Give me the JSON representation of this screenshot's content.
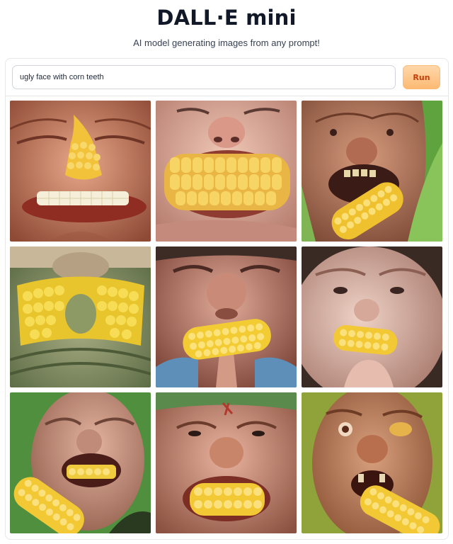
{
  "app": {
    "title": "DALL·E mini",
    "subtitle": "AI model generating images from any prompt!"
  },
  "prompt": {
    "value": "ugly face with corn teeth"
  },
  "run_button": {
    "label": "Run"
  },
  "colors": {
    "run_accent": "#c2410c",
    "run_background": "#fed7aa",
    "corn": "#f5c542"
  },
  "gallery": {
    "images": [
      {
        "depicts": "generated-image-1"
      },
      {
        "depicts": "generated-image-2"
      },
      {
        "depicts": "generated-image-3"
      },
      {
        "depicts": "generated-image-4"
      },
      {
        "depicts": "generated-image-5"
      },
      {
        "depicts": "generated-image-6"
      },
      {
        "depicts": "generated-image-7"
      },
      {
        "depicts": "generated-image-8"
      },
      {
        "depicts": "generated-image-9"
      }
    ]
  }
}
